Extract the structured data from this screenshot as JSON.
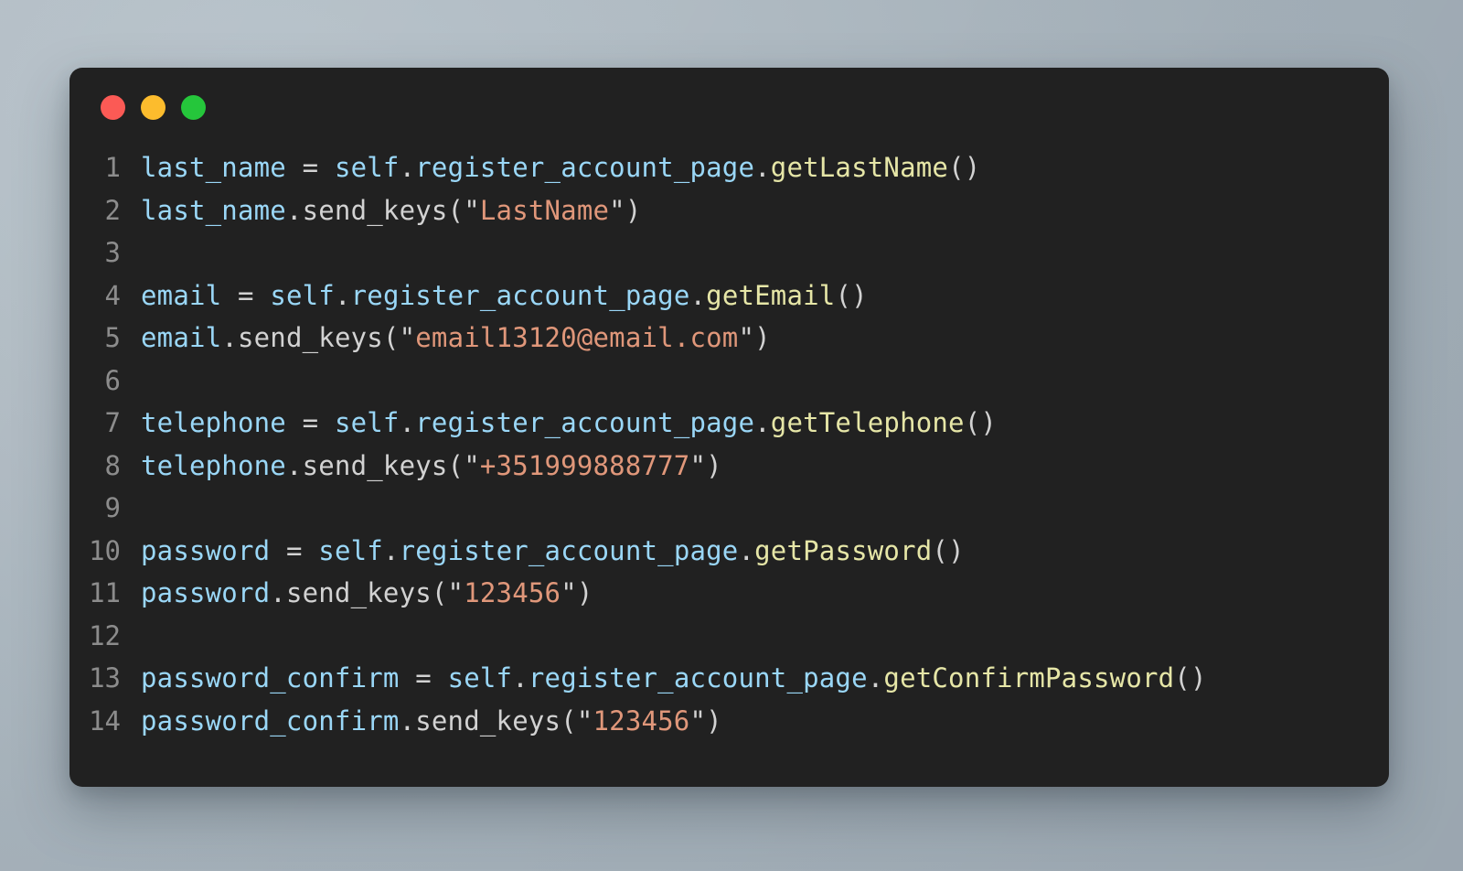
{
  "window": {
    "name": "code-snippet-window",
    "background_color": "#212121",
    "page_background_color": "#aab6bf",
    "traffic_lights": [
      {
        "name": "close-button",
        "color": "#fb5a55"
      },
      {
        "name": "minimize-button",
        "color": "#fcbc2d"
      },
      {
        "name": "maximize-button",
        "color": "#25c63b"
      }
    ]
  },
  "editor": {
    "language": "python",
    "palette": {
      "variable": "#9ad7f7",
      "function": "#e6e6a7",
      "string": "#e0977a",
      "punctuation": "#d2d2d2",
      "line_number": "#8c8c8c"
    },
    "lines": [
      {
        "number": "1",
        "plain": "last_name = self.register_account_page.getLastName()",
        "tokens": [
          {
            "text": "last_name",
            "type": "variable"
          },
          {
            "text": " ",
            "type": "punctuation"
          },
          {
            "text": "=",
            "type": "punctuation"
          },
          {
            "text": " ",
            "type": "punctuation"
          },
          {
            "text": "self",
            "type": "variable"
          },
          {
            "text": ".",
            "type": "punctuation"
          },
          {
            "text": "register_account_page",
            "type": "variable"
          },
          {
            "text": ".",
            "type": "punctuation"
          },
          {
            "text": "getLastName",
            "type": "function"
          },
          {
            "text": "()",
            "type": "punctuation"
          }
        ]
      },
      {
        "number": "2",
        "plain": "last_name.send_keys(\"LastName\")",
        "tokens": [
          {
            "text": "last_name",
            "type": "variable"
          },
          {
            "text": ".",
            "type": "punctuation"
          },
          {
            "text": "send_keys",
            "type": "punctuation"
          },
          {
            "text": "(\"",
            "type": "punctuation"
          },
          {
            "text": "LastName",
            "type": "string"
          },
          {
            "text": "\")",
            "type": "punctuation"
          }
        ]
      },
      {
        "number": "3",
        "plain": "",
        "tokens": []
      },
      {
        "number": "4",
        "plain": "email = self.register_account_page.getEmail()",
        "tokens": [
          {
            "text": "email",
            "type": "variable"
          },
          {
            "text": " ",
            "type": "punctuation"
          },
          {
            "text": "=",
            "type": "punctuation"
          },
          {
            "text": " ",
            "type": "punctuation"
          },
          {
            "text": "self",
            "type": "variable"
          },
          {
            "text": ".",
            "type": "punctuation"
          },
          {
            "text": "register_account_page",
            "type": "variable"
          },
          {
            "text": ".",
            "type": "punctuation"
          },
          {
            "text": "getEmail",
            "type": "function"
          },
          {
            "text": "()",
            "type": "punctuation"
          }
        ]
      },
      {
        "number": "5",
        "plain": "email.send_keys(\"email13120@email.com\")",
        "tokens": [
          {
            "text": "email",
            "type": "variable"
          },
          {
            "text": ".",
            "type": "punctuation"
          },
          {
            "text": "send_keys",
            "type": "punctuation"
          },
          {
            "text": "(\"",
            "type": "punctuation"
          },
          {
            "text": "email13120@email.com",
            "type": "string"
          },
          {
            "text": "\")",
            "type": "punctuation"
          }
        ]
      },
      {
        "number": "6",
        "plain": "",
        "tokens": []
      },
      {
        "number": "7",
        "plain": "telephone = self.register_account_page.getTelephone()",
        "tokens": [
          {
            "text": "telephone",
            "type": "variable"
          },
          {
            "text": " ",
            "type": "punctuation"
          },
          {
            "text": "=",
            "type": "punctuation"
          },
          {
            "text": " ",
            "type": "punctuation"
          },
          {
            "text": "self",
            "type": "variable"
          },
          {
            "text": ".",
            "type": "punctuation"
          },
          {
            "text": "register_account_page",
            "type": "variable"
          },
          {
            "text": ".",
            "type": "punctuation"
          },
          {
            "text": "getTelephone",
            "type": "function"
          },
          {
            "text": "()",
            "type": "punctuation"
          }
        ]
      },
      {
        "number": "8",
        "plain": "telephone.send_keys(\"+351999888777\")",
        "tokens": [
          {
            "text": "telephone",
            "type": "variable"
          },
          {
            "text": ".",
            "type": "punctuation"
          },
          {
            "text": "send_keys",
            "type": "punctuation"
          },
          {
            "text": "(\"",
            "type": "punctuation"
          },
          {
            "text": "+351999888777",
            "type": "string"
          },
          {
            "text": "\")",
            "type": "punctuation"
          }
        ]
      },
      {
        "number": "9",
        "plain": "",
        "tokens": []
      },
      {
        "number": "10",
        "plain": "password = self.register_account_page.getPassword()",
        "tokens": [
          {
            "text": "password",
            "type": "variable"
          },
          {
            "text": " ",
            "type": "punctuation"
          },
          {
            "text": "=",
            "type": "punctuation"
          },
          {
            "text": " ",
            "type": "punctuation"
          },
          {
            "text": "self",
            "type": "variable"
          },
          {
            "text": ".",
            "type": "punctuation"
          },
          {
            "text": "register_account_page",
            "type": "variable"
          },
          {
            "text": ".",
            "type": "punctuation"
          },
          {
            "text": "getPassword",
            "type": "function"
          },
          {
            "text": "()",
            "type": "punctuation"
          }
        ]
      },
      {
        "number": "11",
        "plain": "password.send_keys(\"123456\")",
        "tokens": [
          {
            "text": "password",
            "type": "variable"
          },
          {
            "text": ".",
            "type": "punctuation"
          },
          {
            "text": "send_keys",
            "type": "punctuation"
          },
          {
            "text": "(\"",
            "type": "punctuation"
          },
          {
            "text": "123456",
            "type": "string"
          },
          {
            "text": "\")",
            "type": "punctuation"
          }
        ]
      },
      {
        "number": "12",
        "plain": "",
        "tokens": []
      },
      {
        "number": "13",
        "plain": "password_confirm = self.register_account_page.getConfirmPassword()",
        "tokens": [
          {
            "text": "password_confirm",
            "type": "variable"
          },
          {
            "text": " ",
            "type": "punctuation"
          },
          {
            "text": "=",
            "type": "punctuation"
          },
          {
            "text": " ",
            "type": "punctuation"
          },
          {
            "text": "self",
            "type": "variable"
          },
          {
            "text": ".",
            "type": "punctuation"
          },
          {
            "text": "register_account_page",
            "type": "variable"
          },
          {
            "text": ".",
            "type": "punctuation"
          },
          {
            "text": "getConfirmPassword",
            "type": "function"
          },
          {
            "text": "()",
            "type": "punctuation"
          }
        ]
      },
      {
        "number": "14",
        "plain": "password_confirm.send_keys(\"123456\")",
        "tokens": [
          {
            "text": "password_confirm",
            "type": "variable"
          },
          {
            "text": ".",
            "type": "punctuation"
          },
          {
            "text": "send_keys",
            "type": "punctuation"
          },
          {
            "text": "(\"",
            "type": "punctuation"
          },
          {
            "text": "123456",
            "type": "string"
          },
          {
            "text": "\")",
            "type": "punctuation"
          }
        ]
      }
    ]
  }
}
